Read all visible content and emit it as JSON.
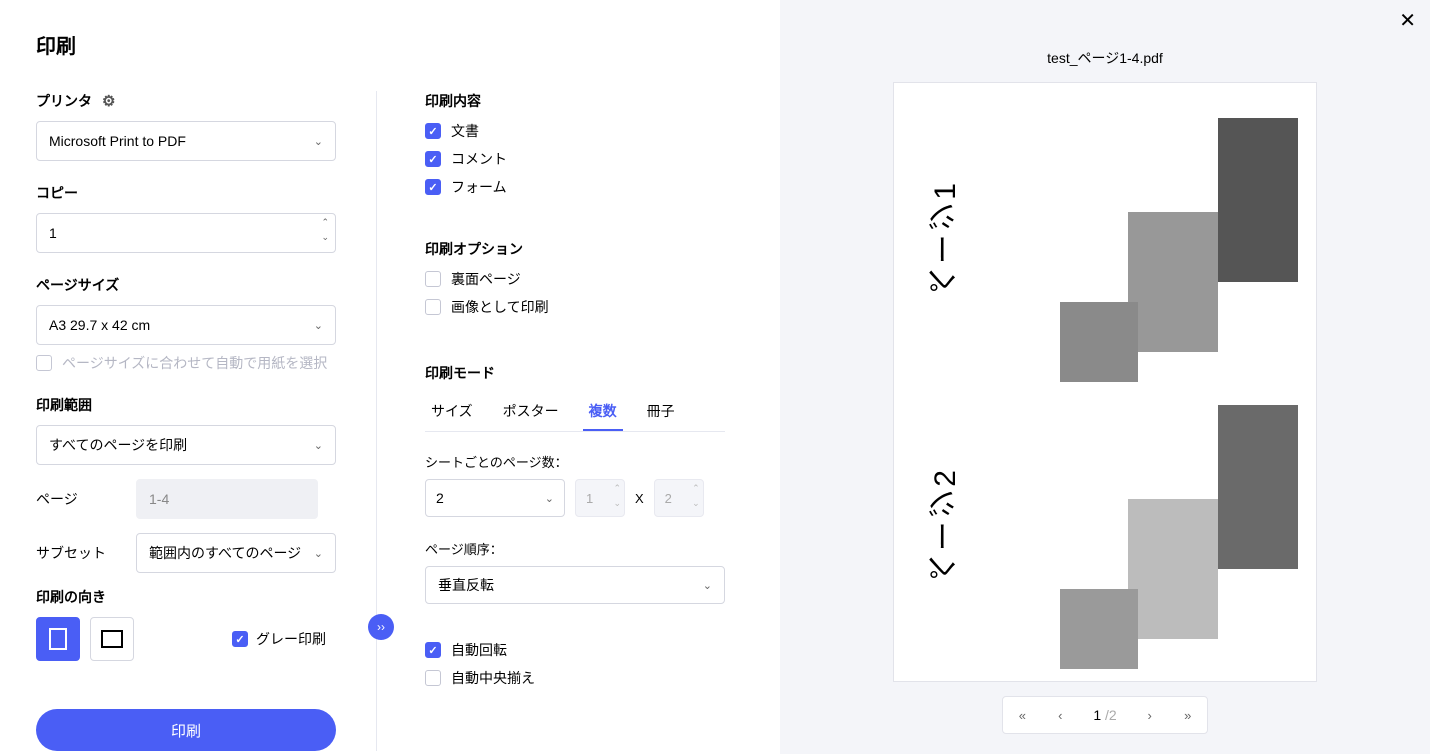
{
  "title": "印刷",
  "printer": {
    "label": "プリンタ",
    "value": "Microsoft Print to PDF"
  },
  "copies": {
    "label": "コピー",
    "value": "1"
  },
  "pageSize": {
    "label": "ページサイズ",
    "value": "A3 29.7 x 42 cm",
    "autoFit": "ページサイズに合わせて自動で用紙を選択"
  },
  "range": {
    "label": "印刷範囲",
    "value": "すべてのページを印刷",
    "pagesLabel": "ページ",
    "pagesPlaceholder": "1-4",
    "subsetLabel": "サブセット",
    "subsetValue": "範囲内のすべてのページ"
  },
  "orientation": {
    "label": "印刷の向き",
    "grayscale": "グレー印刷"
  },
  "content": {
    "label": "印刷内容",
    "document": "文書",
    "comments": "コメント",
    "forms": "フォーム"
  },
  "options": {
    "label": "印刷オプション",
    "reverse": "裏面ページ",
    "asImage": "画像として印刷"
  },
  "mode": {
    "label": "印刷モード",
    "tabs": [
      "サイズ",
      "ポスター",
      "複数",
      "冊子"
    ],
    "pagesPerSheetLabel": "シートごとのページ数：",
    "pagesPerSheetValue": "2",
    "dim1": "1",
    "dim2": "2",
    "orderLabel": "ページ順序：",
    "orderValue": "垂直反転",
    "autoRotate": "自動回転",
    "autoCenter": "自動中央揃え"
  },
  "printButton": "印刷",
  "preview": {
    "filename": "test_ページ1-4.pdf",
    "page1Text": "ページ1",
    "page2Text": "ページ2",
    "current": "1",
    "total": "2"
  }
}
